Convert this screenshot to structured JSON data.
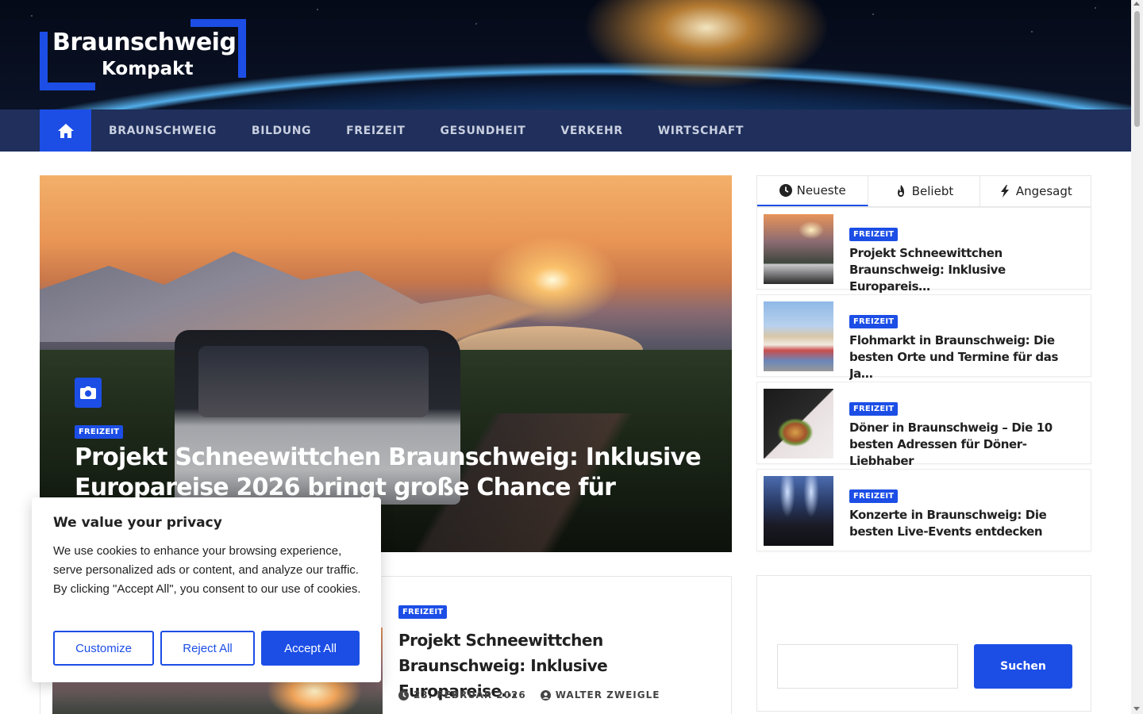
{
  "site": {
    "logo_line1": "Braunschweig",
    "logo_line2": "Kompakt"
  },
  "nav": {
    "items": [
      {
        "label": "BRAUNSCHWEIG"
      },
      {
        "label": "BILDUNG"
      },
      {
        "label": "FREIZEIT"
      },
      {
        "label": "GESUNDHEIT"
      },
      {
        "label": "VERKEHR"
      },
      {
        "label": "WIRTSCHAFT"
      }
    ]
  },
  "hero": {
    "category": "FREIZEIT",
    "title": "Projekt Schneewittchen Braunschweig: Inklusive Europareise 2026 bringt große Chance für Teilhabe"
  },
  "second_article": {
    "category": "FREIZEIT",
    "title": "Projekt Schneewittchen Braunschweig: Inklusive Europareise…",
    "date": "23. FEBRUAR 2026",
    "author": "WALTER ZWEIGLE"
  },
  "sidebar": {
    "tabs": [
      {
        "label": "Neueste",
        "icon": "clock-icon"
      },
      {
        "label": "Beliebt",
        "icon": "fire-icon"
      },
      {
        "label": "Angesagt",
        "icon": "bolt-icon"
      }
    ],
    "posts": [
      {
        "category": "FREIZEIT",
        "title": "Projekt Schneewittchen Braunschweig: Inklusive Europareis…"
      },
      {
        "category": "FREIZEIT",
        "title": "Flohmarkt in Braunschweig: Die besten Orte und Termine für das Ja…"
      },
      {
        "category": "FREIZEIT",
        "title": "Döner in Braunschweig – Die 10 besten Adressen für Döner-Liebhaber"
      },
      {
        "category": "FREIZEIT",
        "title": "Konzerte in Braunschweig: Die besten Live-Events entdecken"
      }
    ]
  },
  "search": {
    "button": "Suchen",
    "value": ""
  },
  "cookie": {
    "title": "We value your privacy",
    "text": "We use cookies to enhance your browsing experience, serve personalized ads or content, and analyze our traffic. By clicking \"Accept All\", you consent to our use of cookies.",
    "customize": "Customize",
    "reject": "Reject All",
    "accept": "Accept All"
  },
  "colors": {
    "accent": "#1c4ee6",
    "nav_bg": "#202f5b"
  }
}
